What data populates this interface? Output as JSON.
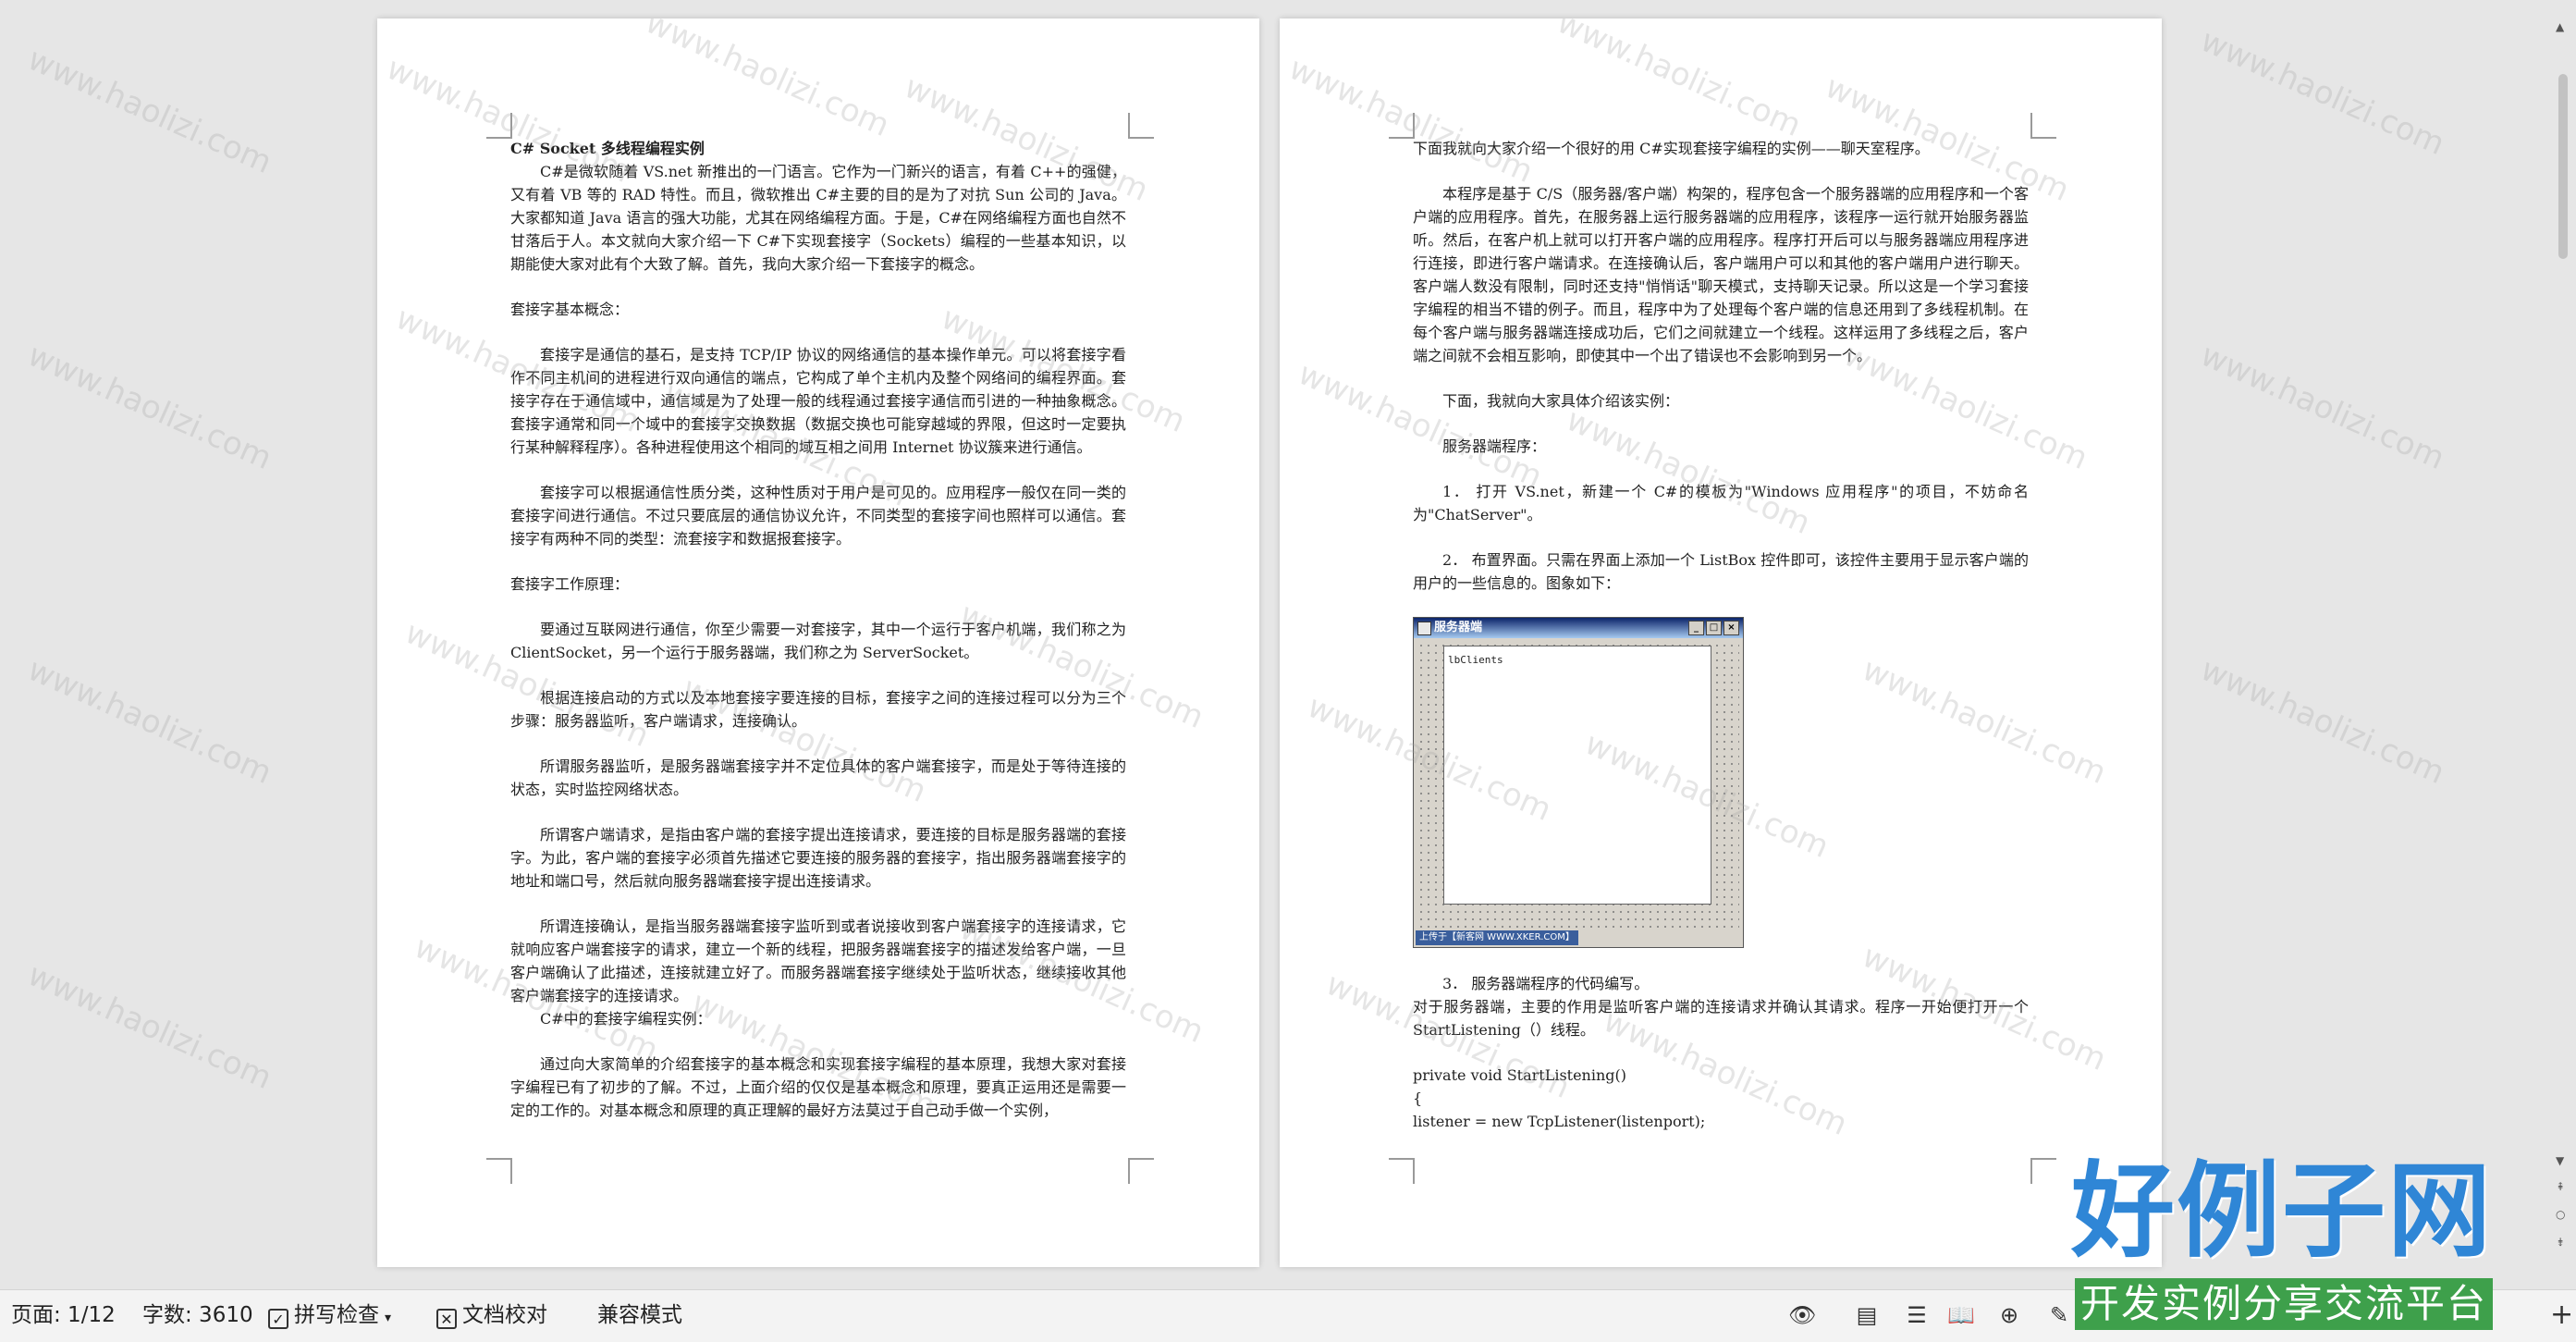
{
  "left_page": {
    "title": "C# Socket 多线程编程实例",
    "paragraphs": [
      "C#是微软随着 VS.net 新推出的一门语言。它作为一门新兴的语言，有着 C++的强健，又有着 VB 等的 RAD 特性。而且，微软推出 C#主要的目的是为了对抗 Sun 公司的 Java。大家都知道 Java 语言的强大功能，尤其在网络编程方面。于是，C#在网络编程方面也自然不甘落后于人。本文就向大家介绍一下 C#下实现套接字（Sockets）编程的一些基本知识，以期能使大家对此有个大致了解。首先，我向大家介绍一下套接字的概念。",
      "套接字基本概念：",
      "套接字是通信的基石，是支持 TCP/IP 协议的网络通信的基本操作单元。可以将套接字看作不同主机间的进程进行双向通信的端点，它构成了单个主机内及整个网络间的编程界面。套接字存在于通信域中，通信域是为了处理一般的线程通过套接字通信而引进的一种抽象概念。套接字通常和同一个域中的套接字交换数据（数据交换也可能穿越域的界限，但这时一定要执行某种解释程序）。各种进程使用这个相同的域互相之间用 Internet 协议簇来进行通信。",
      "套接字可以根据通信性质分类，这种性质对于用户是可见的。应用程序一般仅在同一类的套接字间进行通信。不过只要底层的通信协议允许，不同类型的套接字间也照样可以通信。套接字有两种不同的类型：流套接字和数据报套接字。",
      "套接字工作原理：",
      "要通过互联网进行通信，你至少需要一对套接字，其中一个运行于客户机端，我们称之为 ClientSocket，另一个运行于服务器端，我们称之为 ServerSocket。",
      "根据连接启动的方式以及本地套接字要连接的目标，套接字之间的连接过程可以分为三个步骤：服务器监听，客户端请求，连接确认。",
      "所谓服务器监听，是服务器端套接字并不定位具体的客户端套接字，而是处于等待连接的状态，实时监控网络状态。",
      "所谓客户端请求，是指由客户端的套接字提出连接请求，要连接的目标是服务器端的套接字。为此，客户端的套接字必须首先描述它要连接的服务器的套接字，指出服务器端套接字的地址和端口号，然后就向服务器端套接字提出连接请求。",
      "所谓连接确认，是指当服务器端套接字监听到或者说接收到客户端套接字的连接请求，它就响应客户端套接字的请求，建立一个新的线程，把服务器端套接字的描述发给客户端，一旦客户端确认了此描述，连接就建立好了。而服务器端套接字继续处于监听状态，继续接收其他客户端套接字的连接请求。",
      "C#中的套接字编程实例：",
      "通过向大家简单的介绍套接字的基本概念和实现套接字编程的基本原理，我想大家对套接字编程已有了初步的了解。不过，上面介绍的仅仅是基本概念和原理，要真正运用还是需要一定的工作的。对基本概念和原理的真正理解的最好方法莫过于自己动手做一个实例，"
    ]
  },
  "right_page": {
    "paragraphs_top": [
      "下面我就向大家介绍一个很好的用 C#实现套接字编程的实例——聊天室程序。",
      "本程序是基于 C/S（服务器/客户端）构架的，程序包含一个服务器端的应用程序和一个客户端的应用程序。首先，在服务器上运行服务器端的应用程序，该程序一运行就开始服务器监听。然后，在客户机上就可以打开客户端的应用程序。程序打开后可以与服务器端应用程序进行连接，即进行客户端请求。在连接确认后，客户端用户可以和其他的客户端用户进行聊天。客户端人数没有限制，同时还支持\"悄悄话\"聊天模式，支持聊天记录。所以这是一个学习套接字编程的相当不错的例子。而且，程序中为了处理每个客户端的信息还用到了多线程机制。在每个客户端与服务器端连接成功后，它们之间就建立一个线程。这样运用了多线程之后，客户端之间就不会相互影响，即使其中一个出了错误也不会影响到另一个。",
      "下面，我就向大家具体介绍该实例：",
      "服务器端程序：",
      "1．  打开 VS.net，新建一个 C#的模板为\"Windows 应用程序\"的项目，不妨命名为\"ChatServer\"。",
      "2．  布置界面。只需在界面上添加一个 ListBox 控件即可，该控件主要用于显示客户端的用户的一些信息的。图象如下："
    ],
    "figure": {
      "window_title": "服务器端",
      "listbox_name": "lbClients",
      "footer": "上传于【新客网 WWW.XKER.COM】"
    },
    "step3": "3．  服务器端程序的代码编写。",
    "paragraph_after": "对于服务器端，主要的作用是监听客户端的连接请求并确认其请求。程序一开始便打开一个 StartListening（）线程。",
    "code": [
      "private void StartListening()",
      "{",
      "      listener = new TcpListener(listenport);"
    ]
  },
  "watermark": "www.haolizi.com",
  "statusbar": {
    "page": "页面: 1/12",
    "words": "字数: 3610",
    "spellcheck": "拼写检查",
    "proofread": "文档校对",
    "compat": "兼容模式",
    "plus": "+"
  },
  "logo": {
    "main": "好例子网",
    "sub": "开发实例分享交流平台"
  },
  "colors": {
    "background": "#e6e6e6",
    "logo_blue": "#2f86d6",
    "logo_green": "#3ea04b"
  }
}
